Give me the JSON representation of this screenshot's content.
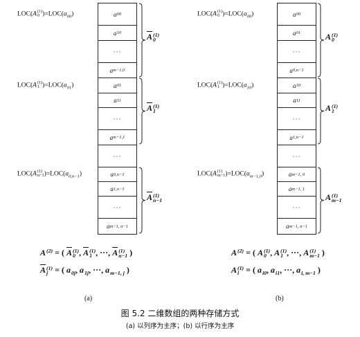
{
  "diagrams": [
    {
      "id": "a",
      "sublabel": "(a)",
      "cells": [
        {
          "base": "a",
          "sub": "00"
        },
        {
          "base": "a",
          "sub": "10"
        },
        {
          "base": "",
          "sub": "",
          "dots": "···"
        },
        {
          "base": "a",
          "sub": "m−1,0"
        },
        {
          "base": "a",
          "sub": "01"
        },
        {
          "base": "a",
          "sub": "11"
        },
        {
          "base": "",
          "sub": "",
          "dots": "···"
        },
        {
          "base": "a",
          "sub": "m−1,1"
        },
        {
          "base": "",
          "sub": "",
          "dots": "···"
        },
        {
          "base": "a",
          "sub": "0,n−1"
        },
        {
          "base": "a",
          "sub": "1,n−1"
        },
        {
          "base": "",
          "sub": "",
          "dots": "···"
        },
        {
          "base": "a",
          "sub": "m−1, n−1"
        }
      ],
      "locs": [
        {
          "pre": "LOC(",
          "base": "A",
          "sup": "(1)",
          "sub": "0",
          "mid": ")=LOC(",
          "tbase": "a",
          "tsub": "00",
          "post": ")"
        },
        {
          "pre": "LOC(",
          "base": "A",
          "sup": "(1)",
          "sub": "1",
          "mid": ")=LOC(",
          "tbase": "a",
          "tsub": "01",
          "post": ")"
        },
        {
          "pre": "LOC(",
          "base": "A",
          "sup": "(1)",
          "sub": "n−1",
          "mid": ")=LOC(",
          "tbase": "a",
          "tsub": "0,n−1",
          "post": ")"
        }
      ],
      "groups": [
        {
          "base": "A",
          "bar": true,
          "sup": "(1)",
          "sub": "0"
        },
        {
          "base": "A",
          "bar": true,
          "sup": "(1)",
          "sub": "1"
        },
        {
          "base": "A",
          "bar": true,
          "sup": "(1)",
          "sub": "n−1"
        }
      ],
      "formulas": [
        [
          {
            "t": "A",
            "sup": "(2)"
          },
          {
            "t": " = ( ",
            "np": true
          },
          {
            "t": "A",
            "bar": true,
            "sup": "(1)",
            "sub": "0"
          },
          {
            "t": ", ",
            "np": true
          },
          {
            "t": "A",
            "bar": true,
            "sup": "(1)",
            "sub": "1"
          },
          {
            "t": ", ···, ",
            "np": true
          },
          {
            "t": "A",
            "bar": true,
            "sup": "(1)",
            "sub": "n−1"
          },
          {
            "t": " )",
            "np": true
          }
        ],
        [
          {
            "t": "A",
            "bar": true,
            "sup": "(1)",
            "sub": "j"
          },
          {
            "t": " = ( ",
            "np": true
          },
          {
            "t": "a",
            "sub": "0j"
          },
          {
            "t": ", ",
            "np": true
          },
          {
            "t": "a",
            "sub": "1j"
          },
          {
            "t": ", ···, ",
            "np": true
          },
          {
            "t": "a",
            "sub": "m−1, j"
          },
          {
            "t": " )",
            "np": true
          }
        ]
      ]
    },
    {
      "id": "b",
      "sublabel": "(b)",
      "cells": [
        {
          "base": "a",
          "sub": "00"
        },
        {
          "base": "a",
          "sub": "01"
        },
        {
          "base": "",
          "sub": "",
          "dots": "···"
        },
        {
          "base": "a",
          "sub": "0,n−1"
        },
        {
          "base": "a",
          "sub": "10"
        },
        {
          "base": "a",
          "sub": "11"
        },
        {
          "base": "",
          "sub": "",
          "dots": "···"
        },
        {
          "base": "a",
          "sub": "1,n−1"
        },
        {
          "base": "",
          "sub": "",
          "dots": "···"
        },
        {
          "base": "a",
          "sub": "m−1, 0"
        },
        {
          "base": "a",
          "sub": "m−1, 1"
        },
        {
          "base": "",
          "sub": "",
          "dots": "···"
        },
        {
          "base": "a",
          "sub": "m−1, n−1"
        }
      ],
      "locs": [
        {
          "pre": "LOC(",
          "base": "A",
          "sup": "(1)",
          "sub": "0",
          "mid": ")=LOC(",
          "tbase": "a",
          "tsub": "00",
          "post": ")"
        },
        {
          "pre": "LOC(",
          "base": "A",
          "sup": "(1)",
          "sub": "1",
          "mid": ")=LOC(",
          "tbase": "a",
          "tsub": "10",
          "post": ")"
        },
        {
          "pre": "LOC(",
          "base": "A",
          "sup": "(1)",
          "sub": "m−1",
          "mid": ")=LOC(",
          "tbase": "a",
          "tsub": "m−1,0",
          "post": ")"
        }
      ],
      "groups": [
        {
          "base": "A",
          "bar": false,
          "sup": "(1)",
          "sub": "0"
        },
        {
          "base": "A",
          "bar": false,
          "sup": "(1)",
          "sub": "1"
        },
        {
          "base": "A",
          "bar": false,
          "sup": "(1)",
          "sub": "m−1"
        }
      ],
      "formulas": [
        [
          {
            "t": "A",
            "sup": "(2)"
          },
          {
            "t": " = ( ",
            "np": true
          },
          {
            "t": "A",
            "sup": "(1)",
            "sub": "0"
          },
          {
            "t": ", ",
            "np": true
          },
          {
            "t": "A",
            "sup": "(1)",
            "sub": "1"
          },
          {
            "t": ", ···, ",
            "np": true
          },
          {
            "t": "A",
            "sup": "(1)",
            "sub": "m−1"
          },
          {
            "t": " )",
            "np": true
          }
        ],
        [
          {
            "t": "A",
            "sup": "(1)",
            "sub": "i"
          },
          {
            "t": " = ( ",
            "np": true
          },
          {
            "t": "a",
            "sub": "i0"
          },
          {
            "t": ", ",
            "np": true
          },
          {
            "t": "a",
            "sub": "i1"
          },
          {
            "t": ", ···, ",
            "np": true
          },
          {
            "t": "a",
            "sub": "i, m−1"
          },
          {
            "t": " )",
            "np": true
          }
        ]
      ]
    }
  ],
  "caption": {
    "title": "图 5.2   二维数组的两种存储方式",
    "subtitle": "(a) 以列序为主序；(b) 以行序为主序"
  }
}
